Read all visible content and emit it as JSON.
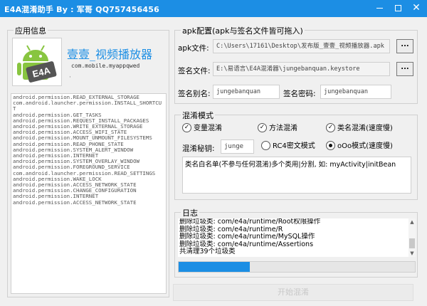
{
  "window": {
    "title": "E4A混淆助手 By : 军哥 QQ757456456",
    "controls": {
      "minimize": "—",
      "maximize": "□",
      "close": "✕"
    }
  },
  "app_info": {
    "group_title": "应用信息",
    "app_name": "壹壹_视频播放器",
    "package": "com.mobile.myappqwed",
    "marker": "·",
    "logo_icon": "android-e4a-logo",
    "logo_text": "E4A",
    "permissions": [
      "android.permission.READ_EXTERNAL_STORAGE",
      "com.android.launcher.permission.INSTALL_SHORTCUT",
      "android.permission.GET_TASKS",
      "android.permission.REQUEST_INSTALL_PACKAGES",
      "android.permission.WRITE_EXTERNAL_STORAGE",
      "android.permission.ACCESS_WIFI_STATE",
      "android.permission.MOUNT_UNMOUNT_FILESYSTEMS",
      "android.permission.READ_PHONE_STATE",
      "android.permission.SYSTEM_ALERT_WINDOW",
      "android.permission.INTERNET",
      "android.permission.SYSTEM_OVERLAY_WINDOW",
      "android.permission.FOREGROUND_SERVICE",
      "com.android.launcher.permission.READ_SETTINGS",
      "android.permission.WAKE_LOCK",
      "android.permission.ACCESS_NETWORK_STATE",
      "android.permission.CHANGE_CONFIGURATION",
      "android.permission.INTERNET",
      "android.permission.ACCESS_NETWORK_STATE"
    ]
  },
  "apk_config": {
    "group_title": "apk配置(apk与签名文件皆可拖入)",
    "apk_label": "apk文件:",
    "apk_path": "C:\\Users\\17161\\Desktop\\发布版_壹壹_视频播放器.apk",
    "sign_label": "签名文件:",
    "sign_path": "E:\\易语言\\E4A混淆器\\jungebanquan.keystore",
    "browse_label": "...",
    "alias_label": "签名别名:",
    "alias_value": "jungebanquan",
    "password_label": "签名密码:",
    "password_value": "jungebanquan"
  },
  "obfuscation": {
    "group_title": "混淆模式",
    "var_label": "变量混淆",
    "method_label": "方法混淆",
    "class_label": "类名混淆(速度慢)",
    "key_label": "混淆秘钥:",
    "key_value": "junge",
    "rc4_label": "RC4密文模式",
    "ooo_label": "oOo模式(速度慢)",
    "whitelist_text": "类名白名单(不参与任何混淆)多个类用|分割, 如: myActivity|initBean"
  },
  "log": {
    "group_title": "日志",
    "lines": [
      "删除垃圾类: com/e4a/runtime/Root权限操作",
      "删除垃圾类: com/e4a/runtime/R",
      "删除垃圾类: com/e4a/runtime/MySQL操作",
      "删除垃圾类: com/e4a/runtime/Assertions",
      "共清理39个垃圾类"
    ],
    "progress": 0.3
  },
  "start_button": "开始混淆",
  "colors": {
    "accent": "#1c8ee4",
    "title_bar": "#1c8ee4"
  }
}
